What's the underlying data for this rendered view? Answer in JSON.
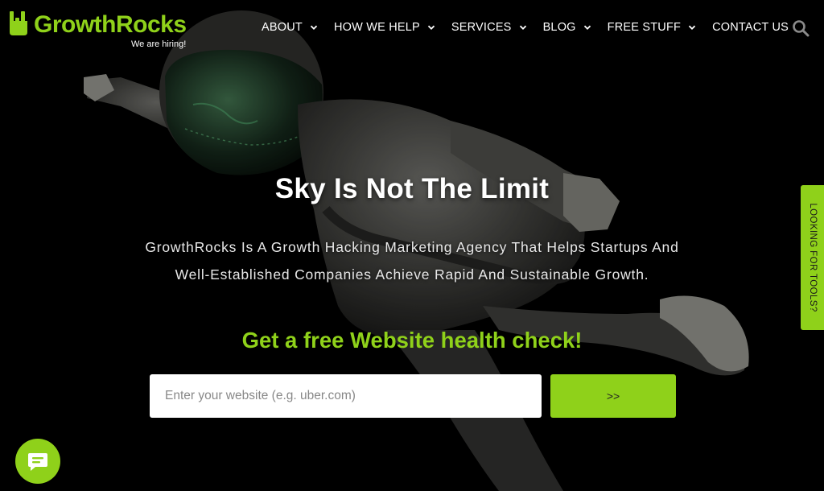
{
  "brand": {
    "name": "GrowthRocks",
    "tagline": "We are hiring!",
    "accent_color": "#8fd11a",
    "logo_icon": "rock-hand-icon"
  },
  "nav": {
    "items": [
      {
        "label": "ABOUT",
        "has_dropdown": true
      },
      {
        "label": "HOW WE HELP",
        "has_dropdown": true
      },
      {
        "label": "SERVICES",
        "has_dropdown": true
      },
      {
        "label": "BLOG",
        "has_dropdown": true
      },
      {
        "label": "FREE STUFF",
        "has_dropdown": true
      },
      {
        "label": "CONTACT US",
        "has_dropdown": false
      }
    ],
    "search_icon": "search-icon"
  },
  "hero": {
    "title": "Sky Is Not The Limit",
    "description": "GrowthRocks Is A Growth Hacking Marketing Agency That Helps Startups And Well-Established Companies Achieve Rapid And Sustainable Growth.",
    "cta_heading": "Get a free Website health check!",
    "input": {
      "placeholder": "Enter your website (e.g. uber.com)",
      "value": ""
    },
    "submit_label": ">>"
  },
  "side_tab": {
    "label": "LOOKING FOR TOOLS?"
  },
  "chat": {
    "icon": "chat-bubble-icon"
  }
}
